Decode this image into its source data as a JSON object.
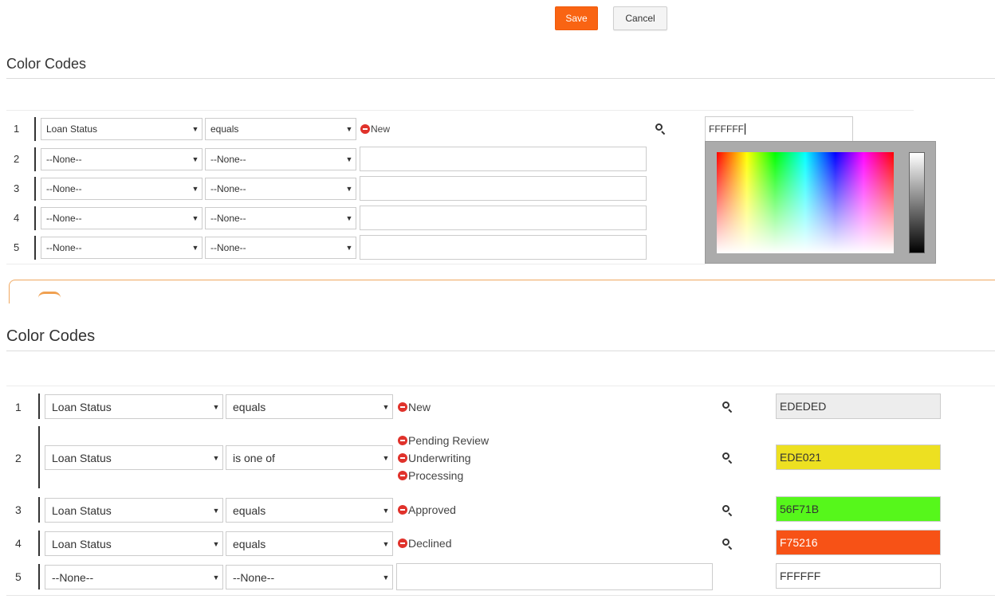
{
  "toolbar": {
    "save_label": "Save",
    "cancel_label": "Cancel"
  },
  "section1": {
    "title": "Color Codes",
    "rows": [
      {
        "num": "1",
        "field": "Loan Status",
        "op": "equals",
        "values": [
          "New"
        ],
        "color": "FFFFFF"
      },
      {
        "num": "2",
        "field": "--None--",
        "op": "--None--"
      },
      {
        "num": "3",
        "field": "--None--",
        "op": "--None--"
      },
      {
        "num": "4",
        "field": "--None--",
        "op": "--None--"
      },
      {
        "num": "5",
        "field": "--None--",
        "op": "--None--"
      }
    ]
  },
  "section2": {
    "title": "Color Codes",
    "rows": [
      {
        "num": "1",
        "field": "Loan Status",
        "op": "equals",
        "values": [
          "New"
        ],
        "color": "EDEDED",
        "bg": "#EDEDED",
        "fg": "#333333"
      },
      {
        "num": "2",
        "field": "Loan Status",
        "op": "is one of",
        "values": [
          "Pending Review",
          "Underwriting",
          "Processing"
        ],
        "color": "EDE021",
        "bg": "#EDE021",
        "fg": "#333333"
      },
      {
        "num": "3",
        "field": "Loan Status",
        "op": "equals",
        "values": [
          "Approved"
        ],
        "color": "56F71B",
        "bg": "#56F71B",
        "fg": "#333333"
      },
      {
        "num": "4",
        "field": "Loan Status",
        "op": "equals",
        "values": [
          "Declined"
        ],
        "color": "F75216",
        "bg": "#F75216",
        "fg": "#FFFFFF"
      },
      {
        "num": "5",
        "field": "--None--",
        "op": "--None--",
        "color": "FFFFFF",
        "bg": "#FFFFFF",
        "fg": "#333333"
      }
    ]
  }
}
